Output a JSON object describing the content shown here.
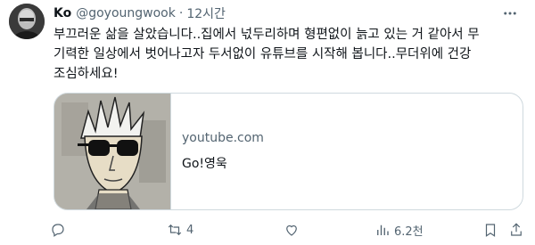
{
  "author": {
    "name": "Ko",
    "handle": "@goyoungwook",
    "separator": "·",
    "time": "12시간"
  },
  "tweet": {
    "text": "부끄러운 삶을 살았습니다..집에서 넋두리하며 형편없이 늙고 있는 거 같아서 무\n기력한 일상에서 벗어나고자 두서없이 유튜브를 시작해 봅니다..무더위에 건강\n조심하세요!"
  },
  "card": {
    "domain": "youtube.com",
    "title": "Go!영욱"
  },
  "actions": {
    "reply_count": "",
    "retweet_count": "4",
    "like_count": "",
    "views_count": "6.2천"
  },
  "colors": {
    "text_primary": "#0f1419",
    "text_secondary": "#536471",
    "border": "#cfd9de"
  },
  "icons": [
    "reply-icon",
    "retweet-icon",
    "like-icon",
    "views-icon",
    "bookmark-icon",
    "share-icon",
    "more-icon"
  ]
}
